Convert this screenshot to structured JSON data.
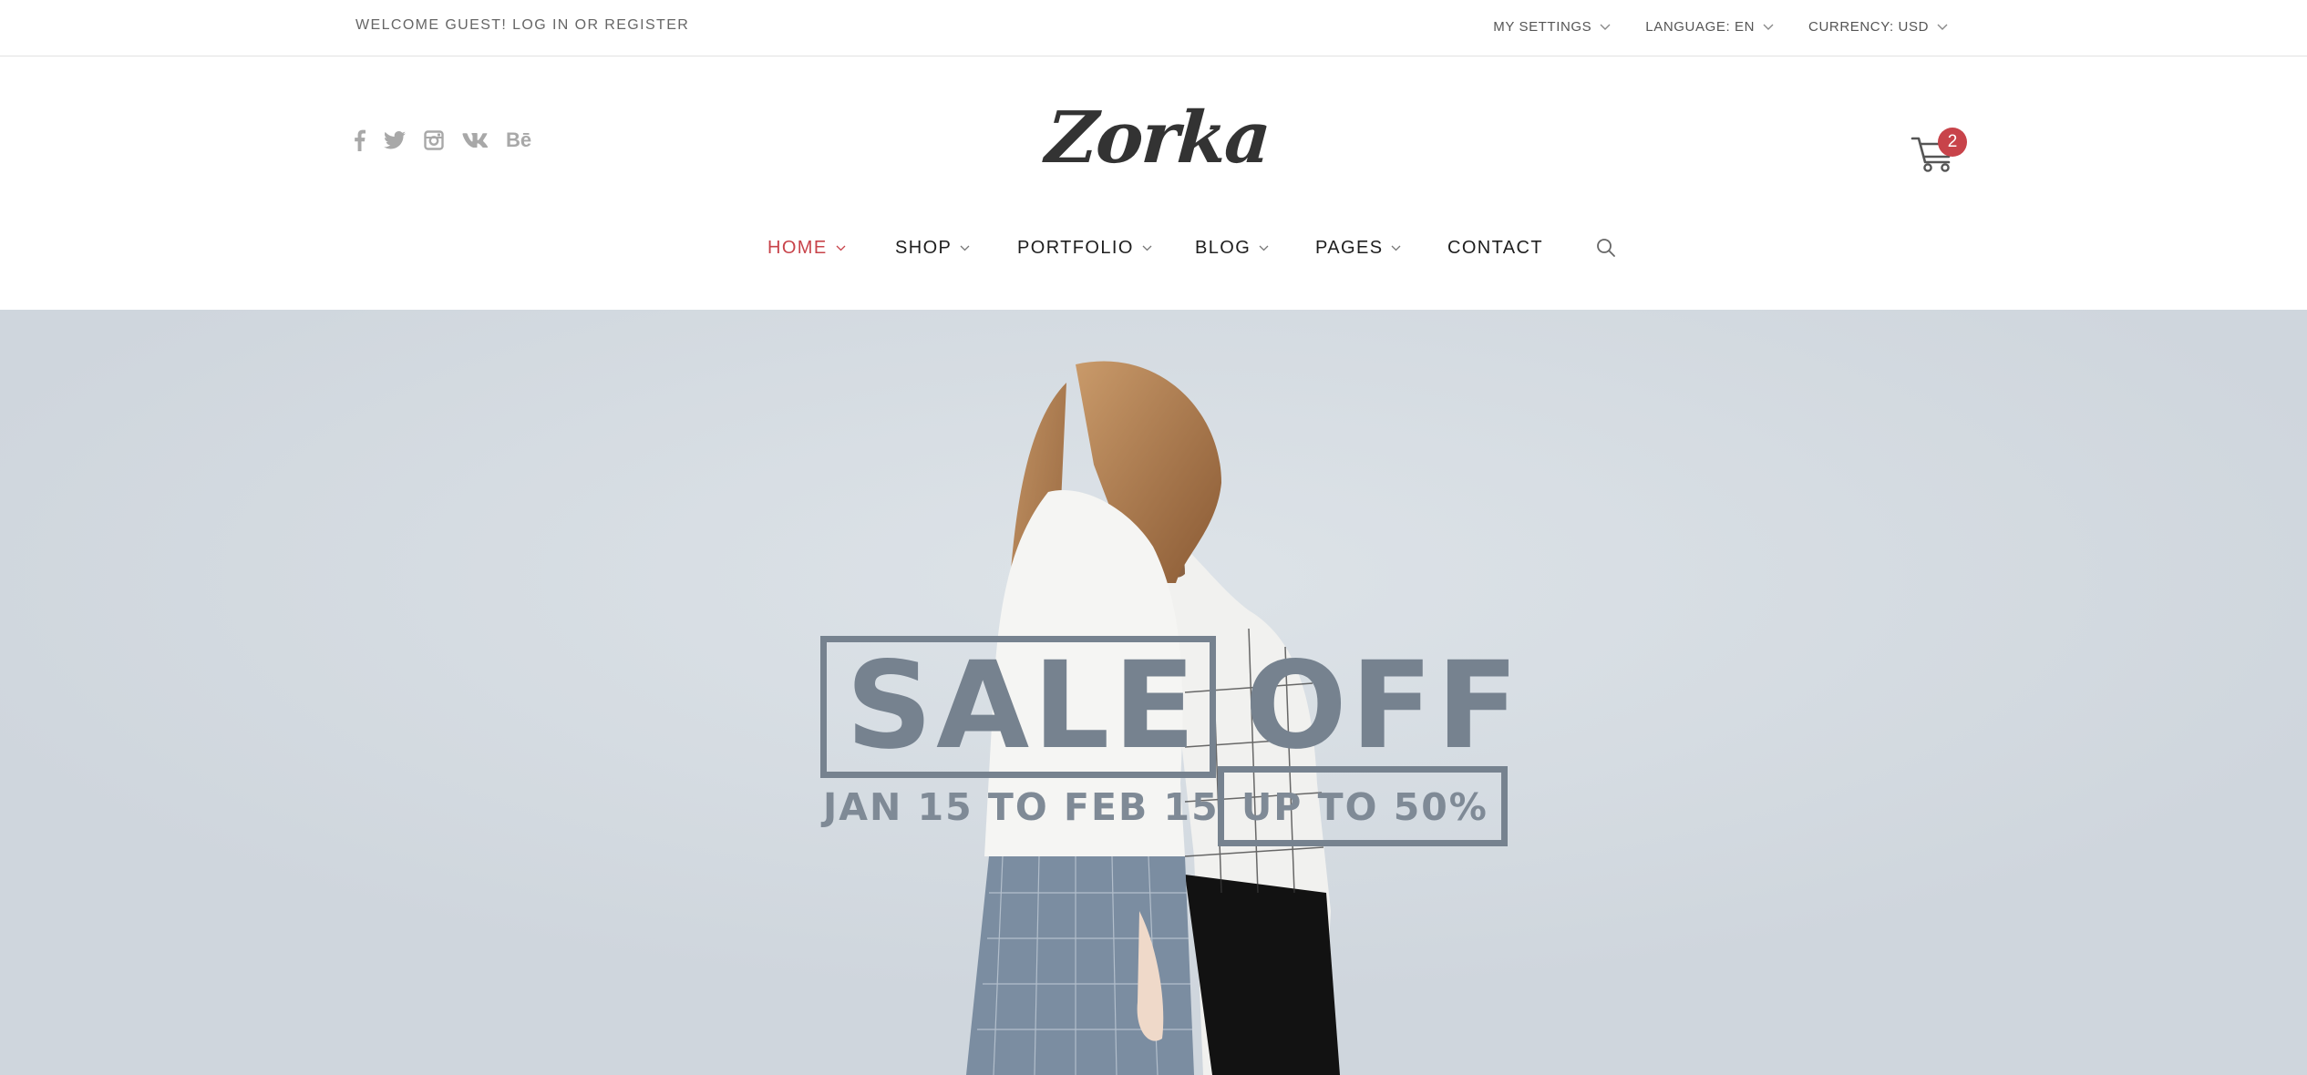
{
  "topbar": {
    "welcome_prefix": "WELCOME GUEST! ",
    "login_label": "LOG IN",
    "or_label": " OR ",
    "register_label": "REGISTER",
    "menu": [
      {
        "label": "MY SETTINGS",
        "icon": "chevron-down-icon"
      },
      {
        "label": "LANGUAGE: EN",
        "icon": "chevron-down-icon"
      },
      {
        "label": "CURRENCY: USD",
        "icon": "chevron-down-icon"
      }
    ]
  },
  "header": {
    "logo_text": "Zorka",
    "social": [
      "facebook-icon",
      "twitter-icon",
      "instagram-icon",
      "vk-icon",
      "behance-icon"
    ],
    "behance_text": "Bē",
    "cart": {
      "icon": "cart-icon",
      "count": "2"
    }
  },
  "nav": {
    "items": [
      {
        "label": "HOME",
        "dropdown": true,
        "active": true
      },
      {
        "label": "SHOP",
        "dropdown": true
      },
      {
        "label": "PORTFOLIO",
        "dropdown": true
      },
      {
        "label": "BLOG",
        "dropdown": true
      },
      {
        "label": "PAGES",
        "dropdown": true
      },
      {
        "label": "CONTACT",
        "dropdown": false
      }
    ],
    "search_icon": "search-icon"
  },
  "hero": {
    "title": "SALE OFF",
    "dates": "JAN 15 TO FEB 15",
    "discount": "UP TO 50%"
  },
  "colors": {
    "accent": "#c8434a",
    "hero_bg": "#cfd6dd",
    "sale_text": "#76828f"
  }
}
